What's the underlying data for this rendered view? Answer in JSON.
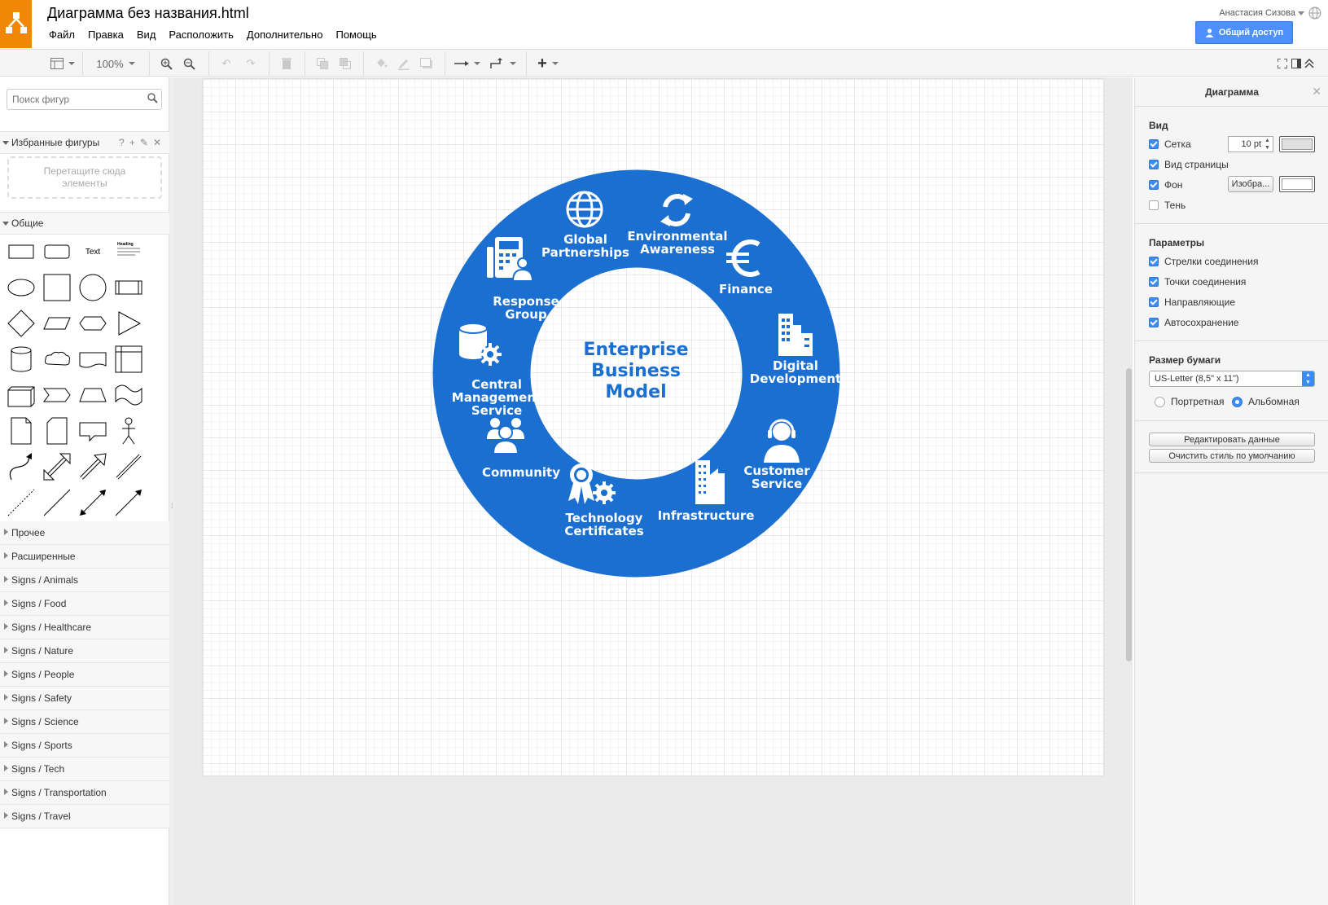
{
  "header": {
    "doc_title": "Диаграмма без названия.html",
    "menu": [
      "Файл",
      "Правка",
      "Вид",
      "Расположить",
      "Дополнительно",
      "Помощь"
    ],
    "user_name": "Анастасия Сизова",
    "share_label": "Общий доступ",
    "brand_color": "#f08705",
    "share_color": "#4d90fe"
  },
  "toolbar": {
    "zoom": "100%"
  },
  "sidebar": {
    "search_placeholder": "Поиск фигур",
    "favorites_title": "Избранные фигуры",
    "favorites_tools": [
      "?",
      "+",
      "✎",
      "✕"
    ],
    "drop_hint": "Перетащите сюда\nэлементы",
    "general_title": "Общие",
    "shape_text": "Text",
    "shape_heading": "Heading",
    "categories": [
      "Прочее",
      "Расширенные",
      "Signs / Animals",
      "Signs / Food",
      "Signs / Healthcare",
      "Signs / Nature",
      "Signs / People",
      "Signs / Safety",
      "Signs / Science",
      "Signs / Sports",
      "Signs / Tech",
      "Signs / Transportation",
      "Signs / Travel"
    ]
  },
  "diagram": {
    "ring_color": "#1a6fd1",
    "center_title": "Enterprise\nBusiness\nModel",
    "segments": [
      {
        "label": "Global\nPartnerships",
        "icon": "globe-icon"
      },
      {
        "label": "Environmental\nAwareness",
        "icon": "recycle-icon"
      },
      {
        "label": "Finance",
        "icon": "euro-icon"
      },
      {
        "label": "Digital\nDevelopment",
        "icon": "buildings-icon"
      },
      {
        "label": "Customer\nService",
        "icon": "headset-icon"
      },
      {
        "label": "Infrastructure",
        "icon": "skyscraper-icon"
      },
      {
        "label": "Technology\nCertificates",
        "icon": "certificate-gear-icon"
      },
      {
        "label": "Community",
        "icon": "people-icon"
      },
      {
        "label": "Central\nManagement\nService",
        "icon": "database-gear-icon"
      },
      {
        "label": "Response\nGroup",
        "icon": "phone-people-icon"
      }
    ]
  },
  "format_panel": {
    "title": "Диаграмма",
    "view_head": "Вид",
    "grid_label": "Сетка",
    "grid_size": "10 pt",
    "page_view_label": "Вид страницы",
    "background_label": "Фон",
    "image_button": "Изобра...",
    "shadow_label": "Тень",
    "options_head": "Параметры",
    "options": [
      {
        "label": "Стрелки соединения",
        "checked": true
      },
      {
        "label": "Точки соединения",
        "checked": true
      },
      {
        "label": "Направляющие",
        "checked": true
      },
      {
        "label": "Автосохранение",
        "checked": true
      }
    ],
    "paper_head": "Размер бумаги",
    "paper_size": "US-Letter (8,5\" x 11\")",
    "portrait": "Портретная",
    "landscape": "Альбомная",
    "edit_data": "Редактировать данные",
    "clear_style": "Очистить стиль по умолчанию"
  }
}
